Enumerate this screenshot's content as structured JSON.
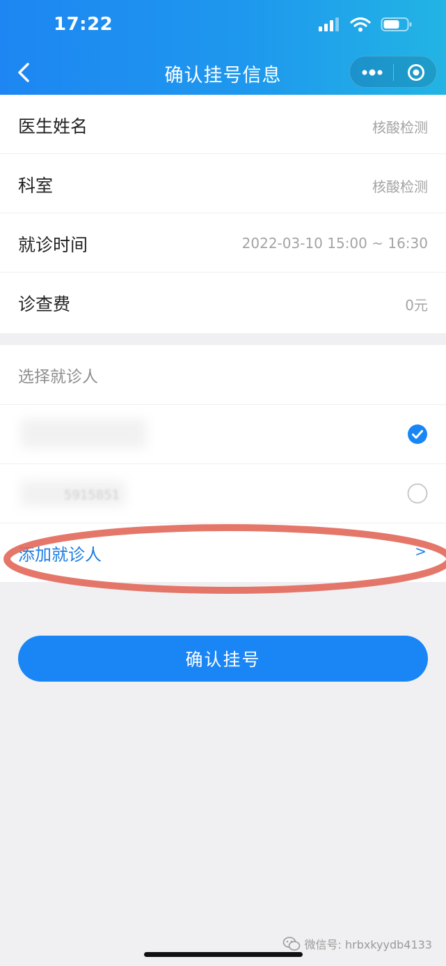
{
  "status_bar": {
    "time": "17:22"
  },
  "nav": {
    "title": "确认挂号信息"
  },
  "info_rows": [
    {
      "label": "医生姓名",
      "value": "核酸检测"
    },
    {
      "label": "科室",
      "value": "核酸检测"
    },
    {
      "label": "就诊时间",
      "value": "2022-03-10 15:00 ~ 16:30"
    },
    {
      "label": "诊查费",
      "value": "0元"
    }
  ],
  "patient_section": {
    "title": "选择就诊人",
    "patients": [
      {
        "selected": true
      },
      {
        "selected": false,
        "masked_text": "5915851"
      }
    ],
    "add_label": "添加就诊人",
    "add_arrow": ">"
  },
  "confirm_button": {
    "label": "确认挂号"
  },
  "watermark": {
    "text": "微信号: hrbxkyydb4133"
  },
  "colors": {
    "accent": "#1a86f6",
    "header_start": "#1d86f2",
    "header_end": "#22b4e4",
    "link": "#1e7de0",
    "annotation_red": "#e2685a"
  }
}
